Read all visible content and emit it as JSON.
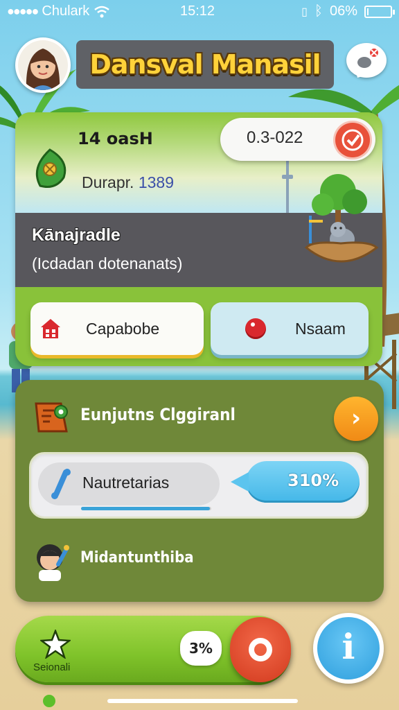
{
  "status_bar": {
    "carrier": "Chulark",
    "signal_dots": "●●●●●",
    "wifi_icon": "wifi-icon",
    "time": "15:12",
    "battery": "06%",
    "battery_level": 0.06
  },
  "header": {
    "title": "Dansval Manasil",
    "avatar_icon": "player-avatar",
    "chat_icon": "chat-bubble-icon"
  },
  "top_card": {
    "cash": "14 oasH",
    "date_value": "0.3-022",
    "date_label": "Durapr.",
    "date_number": "1389",
    "heading": "Kānajradle",
    "subheading": "(Icdadan dotenanats)",
    "buttons": {
      "left_label": "Capabobe",
      "right_label": "Nsaam"
    }
  },
  "mid_panel": {
    "mission_label": "Eunjutns Clggiranl",
    "progress": {
      "name": "Nautretarias",
      "percent_label": "310%",
      "bar_fill": 0.99
    },
    "friend_label": "Midantunthiba"
  },
  "bottom_bar": {
    "star_label": "Seionali",
    "mini_label": "3%",
    "info_label": "i"
  },
  "colors": {
    "card_green": "#89c23a",
    "panel_olive": "#6f8839",
    "title_yellow": "#ffd23a",
    "accent_orange": "#f08a16",
    "accent_blue": "#43b7e8",
    "accent_red": "#e8513a"
  }
}
